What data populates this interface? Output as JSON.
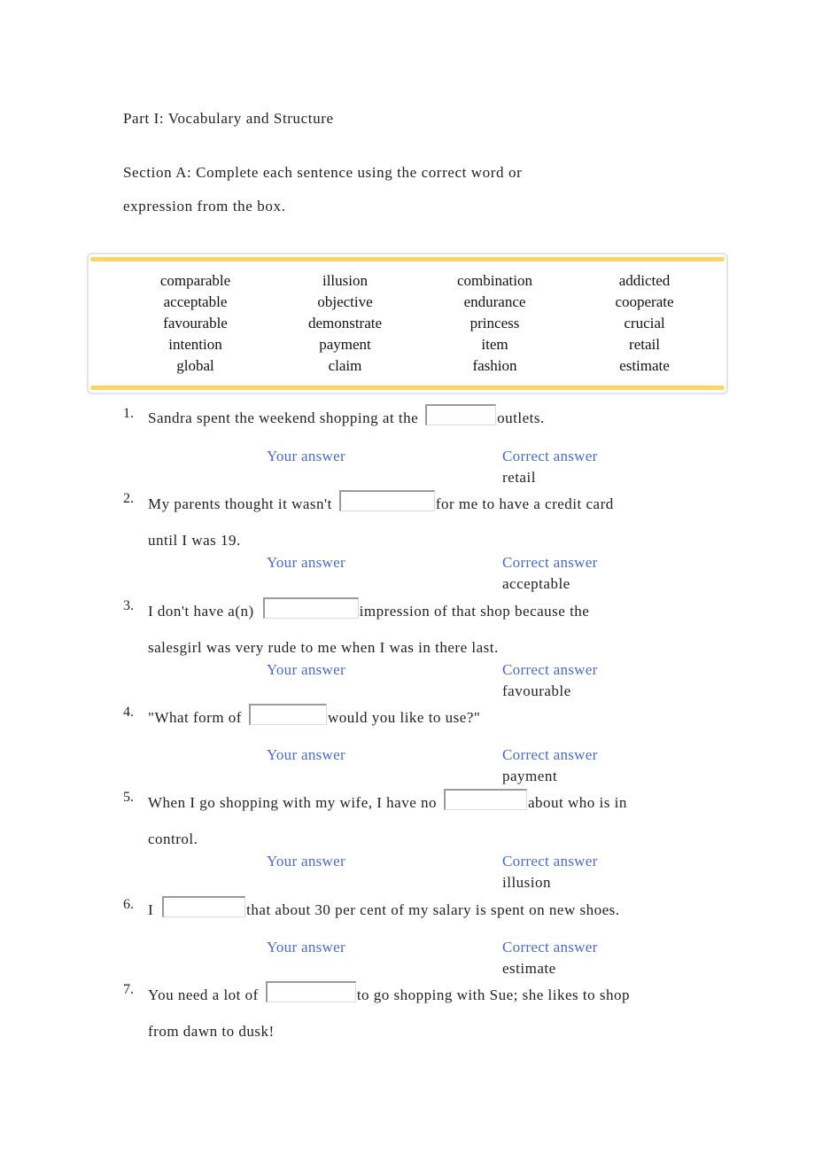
{
  "part_title": "Part I: Vocabulary and Structure",
  "section": {
    "line1": "Section A: Complete each sentence using the correct word or",
    "line2": "expression from the box."
  },
  "word_box": {
    "accent_color": "#fcd665",
    "columns": [
      [
        "comparable",
        "acceptable",
        "favourable",
        "intention",
        "global"
      ],
      [
        "illusion",
        "objective",
        "demonstrate",
        "payment",
        "claim"
      ],
      [
        "combination",
        "endurance",
        "princess",
        "item",
        "fashion"
      ],
      [
        "addicted",
        "cooperate",
        "crucial",
        "retail",
        "estimate"
      ]
    ]
  },
  "labels": {
    "your_answer": "Your answer",
    "correct_answer": "Correct answer",
    "label_color": "#4a6bc0"
  },
  "questions": [
    {
      "number": "1.",
      "before": "Sandra spent the weekend shopping at the",
      "after": "outlets.",
      "line2": "",
      "your_answer_value": "",
      "correct": "retail"
    },
    {
      "number": "2.",
      "before": "My parents thought it wasn't",
      "after": "for me to have a credit card",
      "line2": "until I was 19.",
      "your_answer_value": "",
      "correct": "acceptable"
    },
    {
      "number": "3.",
      "before": "I don't have a(n)",
      "after": "impression of that shop because the",
      "line2": "salesgirl was very rude to me when I was in there last.",
      "your_answer_value": "",
      "correct": "favourable"
    },
    {
      "number": "4.",
      "before": "\"What form of",
      "after": "would you like to use?\"",
      "line2": "",
      "your_answer_value": "",
      "correct": "payment"
    },
    {
      "number": "5.",
      "before": "When I go shopping with my wife, I have no",
      "after": "about who is in",
      "line2": "control.",
      "your_answer_value": "",
      "correct": "illusion"
    },
    {
      "number": "6.",
      "before": "I",
      "after": "that about 30 per cent of my salary is spent on new shoes.",
      "line2": "",
      "your_answer_value": "",
      "correct": "estimate"
    },
    {
      "number": "7.",
      "before": "You need a lot of",
      "after": "to go shopping with Sue; she likes to shop",
      "line2": "from dawn to dusk!",
      "your_answer_value": "",
      "correct": ""
    }
  ]
}
